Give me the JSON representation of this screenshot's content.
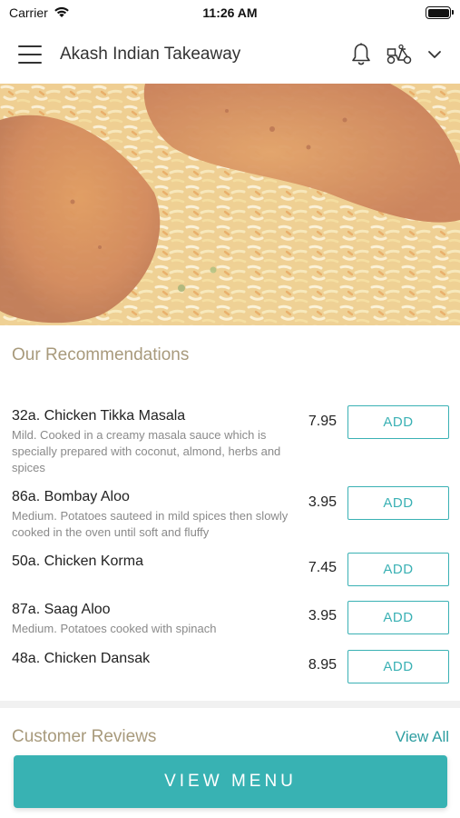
{
  "status_bar": {
    "carrier": "Carrier",
    "time": "11:26 AM",
    "wifi_icon": "wifi-icon",
    "battery_icon": "battery-icon"
  },
  "header": {
    "title": "Akash Indian Takeaway",
    "menu_icon": "hamburger-menu-icon",
    "bell_icon": "bell-icon",
    "delivery_icon": "scooter-icon",
    "dropdown_icon": "chevron-down-icon"
  },
  "hero": {
    "image_description_icon": "food-photo"
  },
  "recommendations": {
    "title": "Our Recommendations",
    "items": [
      {
        "name": "32a. Chicken Tikka Masala",
        "description": "Mild. Cooked in a creamy masala sauce which is specially prepared with coconut, almond, herbs and spices",
        "price": "7.95",
        "button": "ADD"
      },
      {
        "name": "86a. Bombay Aloo",
        "description": "Medium. Potatoes sauteed in mild spices then slowly cooked in the oven until soft and fluffy",
        "price": "3.95",
        "button": "ADD"
      },
      {
        "name": "50a. Chicken Korma",
        "description": "",
        "price": "7.45",
        "button": "ADD"
      },
      {
        "name": "87a. Saag Aloo",
        "description": "Medium. Potatoes cooked with spinach",
        "price": "3.95",
        "button": "ADD"
      },
      {
        "name": "48a. Chicken Dansak",
        "description": "",
        "price": "8.95",
        "button": "ADD"
      }
    ]
  },
  "reviews": {
    "title": "Customer Reviews",
    "view_all": "View All"
  },
  "footer": {
    "view_menu": "VIEW MENU"
  },
  "colors": {
    "accent": "#38b2b3",
    "section_title": "#a89a7c",
    "text": "#222222",
    "muted": "#8a8a8a"
  }
}
